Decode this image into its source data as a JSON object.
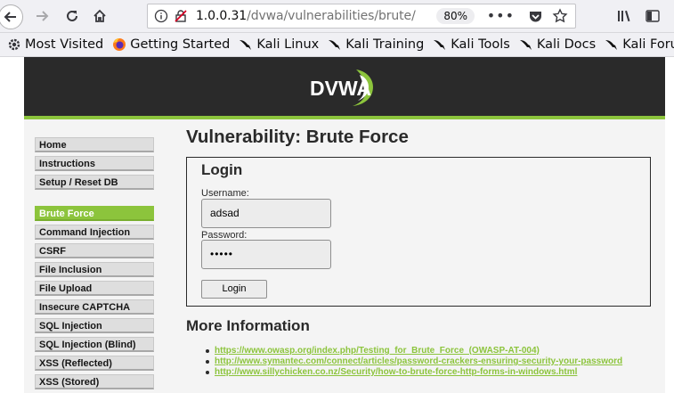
{
  "browser": {
    "url_host": "1.0.0.31",
    "url_path": "/dvwa/vulnerabilities/brute/",
    "zoom": "80%",
    "url_more": "•••"
  },
  "bookmarks": [
    {
      "label": "Most Visited",
      "icon": "gear-icon"
    },
    {
      "label": "Getting Started",
      "icon": "firefox-icon"
    },
    {
      "label": "Kali Linux",
      "icon": "kali-dragon-icon"
    },
    {
      "label": "Kali Training",
      "icon": "kali-dragon-icon"
    },
    {
      "label": "Kali Tools",
      "icon": "kali-dragon-icon"
    },
    {
      "label": "Kali Docs",
      "icon": "kali-dragon-icon"
    },
    {
      "label": "Kali Forums",
      "icon": "kali-dragon-icon"
    }
  ],
  "logo": {
    "text": "DVWA",
    "accent": "#8cc43c"
  },
  "menu": {
    "group1": [
      "Home",
      "Instructions",
      "Setup / Reset DB"
    ],
    "group2": [
      "Brute Force",
      "Command Injection",
      "CSRF",
      "File Inclusion",
      "File Upload",
      "Insecure CAPTCHA",
      "SQL Injection",
      "SQL Injection (Blind)",
      "XSS (Reflected)",
      "XSS (Stored)"
    ],
    "active": "Brute Force"
  },
  "main": {
    "title": "Vulnerability: Brute Force",
    "login_title": "Login",
    "username_label": "Username:",
    "username_value": "adsad",
    "password_label": "Password:",
    "password_value": "•••••",
    "login_button": "Login",
    "more_title": "More Information",
    "links": [
      "https://www.owasp.org/index.php/Testing_for_Brute_Force_(OWASP-AT-004)",
      "http://www.symantec.com/connect/articles/password-crackers-ensuring-security-your-password",
      "http://www.sillychicken.co.nz/Security/how-to-brute-force-http-forms-in-windows.html"
    ]
  },
  "colors": {
    "accent": "#8cc43c",
    "header_bg": "#2a2a2a",
    "page_bg": "#f4f4f4"
  }
}
